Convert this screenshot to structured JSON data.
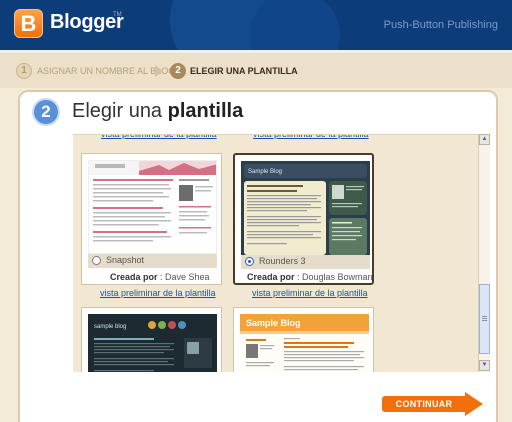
{
  "header": {
    "logo_letter": "B",
    "brand": "Blogger",
    "trademark": "TM",
    "tagline": "Push-Button Publishing"
  },
  "steps": [
    {
      "number": "1",
      "label": "ASIGNAR UN NOMBRE AL BLOG",
      "active": false
    },
    {
      "number": "2",
      "label": "ELEGIR UNA PLANTILLA",
      "active": true
    }
  ],
  "panel": {
    "step_number": "2",
    "title_prefix": "Elegir una ",
    "title_bold": "plantilla"
  },
  "templates": {
    "preview_link_text": "vista preliminar de la plantilla",
    "created_by_label": "Creada por",
    "items": [
      {
        "name": "Snapshot",
        "creator": "Dave Shea",
        "selected": false
      },
      {
        "name": "Rounders 3",
        "creator": "Douglas Bowman",
        "selected": true
      },
      {
        "name": "",
        "creator": "",
        "selected": false
      },
      {
        "name": "",
        "creator": "",
        "selected": false
      }
    ],
    "preview_texts": {
      "sample_blog": "Sample Blog",
      "sample_blog_lower": "sample blog"
    }
  },
  "continue_button": "CONTINUAR",
  "colors": {
    "header_bg": "#0d3d79",
    "accent_orange": "#f26f0c",
    "step_blue": "#5b8fd8",
    "link_blue": "#1f4fa8",
    "cream_bg": "#f3ead8"
  }
}
